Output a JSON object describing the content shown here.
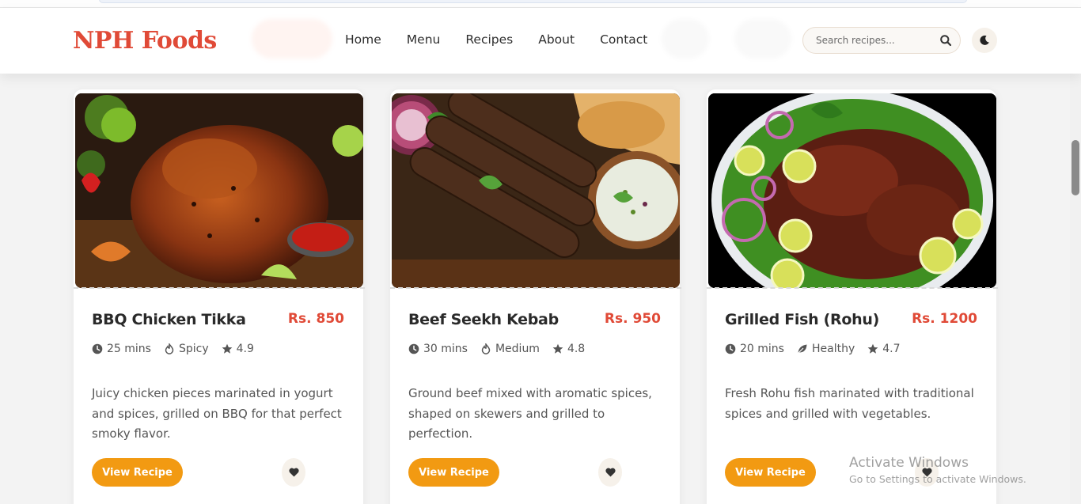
{
  "brand": {
    "name": "NPH Foods",
    "color": "#e04a37"
  },
  "nav": {
    "items": [
      {
        "label": "Home"
      },
      {
        "label": "Menu"
      },
      {
        "label": "Recipes"
      },
      {
        "label": "About"
      },
      {
        "label": "Contact"
      }
    ]
  },
  "search": {
    "placeholder": "Search recipes...",
    "value": "",
    "icon": "search-icon"
  },
  "theme_toggle": {
    "icon": "moon-icon"
  },
  "colors": {
    "accent": "#f29a12",
    "price": "#e04a37"
  },
  "cards": [
    {
      "title": "BBQ Chicken Tikka",
      "price": "Rs. 850",
      "time": "25 mins",
      "level": "Spicy",
      "level_icon": "fire-icon",
      "rating": "4.9",
      "description": "Juicy chicken pieces marinated in yogurt and spices, grilled on BBQ for that perfect smoky flavor.",
      "button": "View Recipe"
    },
    {
      "title": "Beef Seekh Kebab",
      "price": "Rs. 950",
      "time": "30 mins",
      "level": "Medium",
      "level_icon": "fire-icon",
      "rating": "4.8",
      "description": "Ground beef mixed with aromatic spices, shaped on skewers and grilled to perfection.",
      "button": "View Recipe"
    },
    {
      "title": "Grilled Fish (Rohu)",
      "price": "Rs. 1200",
      "time": "20 mins",
      "level": "Healthy",
      "level_icon": "leaf-icon",
      "rating": "4.7",
      "description": "Fresh Rohu fish marinated with traditional spices and grilled with vegetables.",
      "button": "View Recipe"
    }
  ],
  "watermark": {
    "line1": "Activate Windows",
    "line2": "Go to Settings to activate Windows."
  }
}
